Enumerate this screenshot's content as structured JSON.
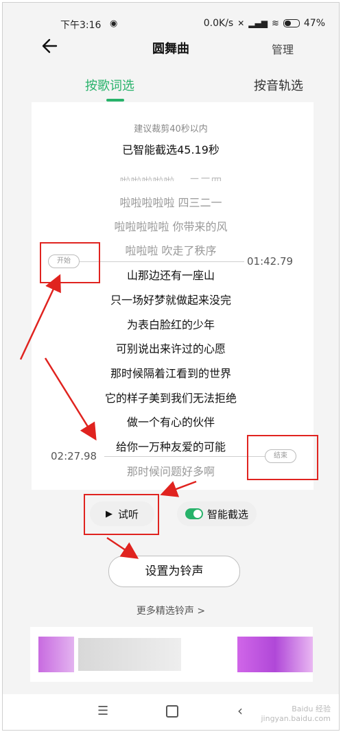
{
  "status_bar": {
    "time": "下午3:16",
    "speed": "0.0K/s",
    "battery": "47%",
    "icons": [
      "location-icon",
      "mute-icon",
      "signal-icon",
      "wifi-icon",
      "battery-icon"
    ]
  },
  "header": {
    "title": "圆舞曲",
    "manage_label": "管理",
    "back_icon": "back-arrow-icon"
  },
  "tabs": [
    {
      "label": "按歌词选",
      "active": true
    },
    {
      "label": "按音轨选",
      "active": false
    }
  ],
  "editor": {
    "hint": "建议裁剪40秒以内",
    "smart_status": "已智能截选45.19秒",
    "cut_line": "啦啦啦啦啦 一二三四",
    "start_marker": "开始",
    "start_time": "01:42.79",
    "end_marker": "结束",
    "end_time": "02:27.98",
    "lyrics": [
      {
        "text": "啦啦啦啦啦 四三二一",
        "selected": false
      },
      {
        "text": "啦啦啦啦啦 你带来的风",
        "selected": false
      },
      {
        "text": "啦啦啦 吹走了秩序",
        "selected": false
      },
      {
        "text": "山那边还有一座山",
        "selected": true
      },
      {
        "text": "只一场好梦就做起来没完",
        "selected": true
      },
      {
        "text": "为表白脸红的少年",
        "selected": true
      },
      {
        "text": "可别说出来许过的心愿",
        "selected": true
      },
      {
        "text": "那时候隔着江看到的世界",
        "selected": true
      },
      {
        "text": "它的样子美到我们无法拒绝",
        "selected": true
      },
      {
        "text": "做一个有心的伙伴",
        "selected": true
      },
      {
        "text": "给你一万种友爱的可能",
        "selected": true
      },
      {
        "text": "那时候问题好多啊",
        "selected": false
      }
    ]
  },
  "controls": {
    "preview_label": "试听",
    "smart_cut_label": "智能截选",
    "smart_cut_on": true,
    "set_ringtone_label": "设置为铃声",
    "more_label": "更多精选铃声 >"
  },
  "colors": {
    "accent": "#27b26a",
    "annotation": "#e0231f"
  },
  "watermark": "Baidu 经验\njingyan.baidu.com"
}
